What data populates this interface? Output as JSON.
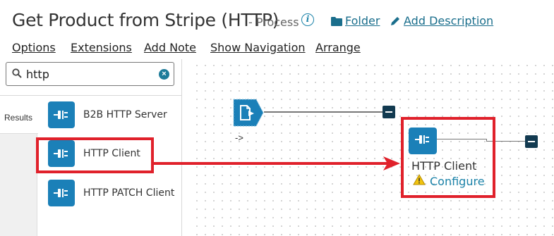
{
  "header": {
    "title": "Get Product from Stripe (HTTP)",
    "subtitle": "- Process",
    "folder_link": "Folder",
    "add_description_link": "Add Description"
  },
  "menu": {
    "items": [
      "Options",
      "Extensions",
      "Add Note",
      "Show Navigation",
      "Arrange"
    ]
  },
  "search": {
    "value": "http"
  },
  "tabs": {
    "results": "Results"
  },
  "results": [
    {
      "label": "B2B HTTP Server",
      "icon": "connector-plug-icon"
    },
    {
      "label": "HTTP Client",
      "icon": "connector-plug-icon"
    },
    {
      "label": "HTTP PATCH Client",
      "icon": "connector-plug-icon"
    }
  ],
  "canvas": {
    "start_arrow_label": "->",
    "node_label": "HTTP Client",
    "configure_label": "Configure",
    "warning_icon": "warning-icon"
  },
  "colors": {
    "accent": "#1b80b8",
    "link": "#1a6e8c",
    "highlight": "#e0212b",
    "dark_button": "#123a50"
  }
}
